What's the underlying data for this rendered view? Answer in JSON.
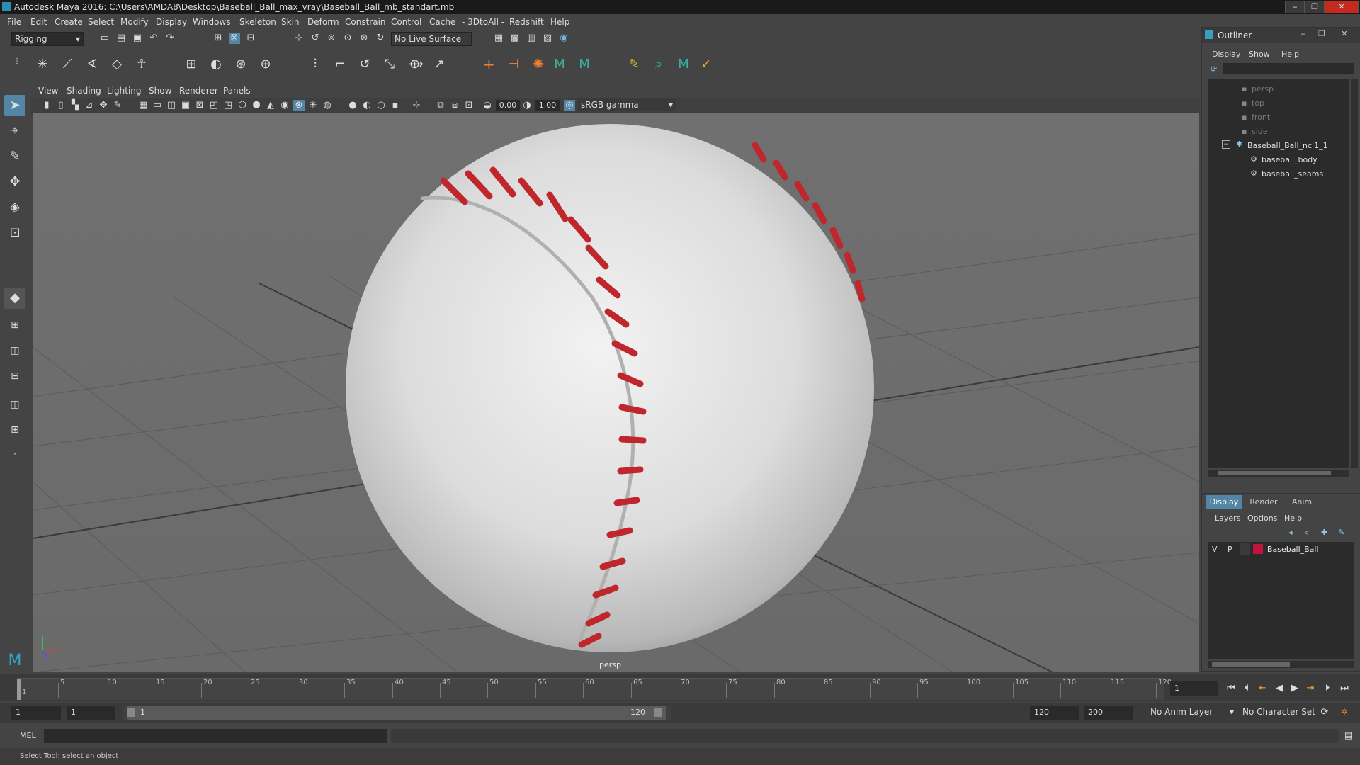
{
  "window": {
    "title": "Autodesk Maya 2016: C:\\Users\\AMDA8\\Desktop\\Baseball_Ball_max_vray\\Baseball_Ball_mb_standart.mb",
    "minimize": "‒",
    "maximize": "❐",
    "close": "✕"
  },
  "menu": [
    "File",
    "Edit",
    "Create",
    "Select",
    "Modify",
    "Display",
    "Windows",
    "Skeleton",
    "Skin",
    "Deform",
    "Constrain",
    "Control",
    "Cache",
    "- 3DtoAll -",
    "Redshift",
    "Help"
  ],
  "toolbar": {
    "mode": "Rigging",
    "live_surface": "No Live Surface"
  },
  "viewport": {
    "menu": [
      "View",
      "Shading",
      "Lighting",
      "Show",
      "Renderer",
      "Panels"
    ],
    "exposure": "0.00",
    "gamma": "1.00",
    "color_space": "sRGB gamma",
    "camera_label": "persp"
  },
  "outliner": {
    "title": "Outliner",
    "menu": [
      "Display",
      "Show",
      "Help"
    ],
    "items": [
      {
        "label": "persp"
      },
      {
        "label": "top"
      },
      {
        "label": "front"
      },
      {
        "label": "side"
      },
      {
        "label": "Baseball_Ball_ncl1_1"
      },
      {
        "label": "baseball_body"
      },
      {
        "label": "baseball_seams"
      }
    ],
    "collapse_glyph": "−"
  },
  "layer_editor": {
    "tabs": [
      "Display",
      "Render",
      "Anim"
    ],
    "menu": [
      "Layers",
      "Options",
      "Help"
    ],
    "layer": {
      "v": "V",
      "p": "P",
      "name": "Baseball_Ball",
      "color": "#c0143c"
    }
  },
  "timeline": {
    "ticks": [
      "1",
      "5",
      "10",
      "15",
      "20",
      "25",
      "30",
      "35",
      "40",
      "45",
      "50",
      "55",
      "60",
      "65",
      "70",
      "75",
      "80",
      "85",
      "90",
      "95",
      "100",
      "105",
      "110",
      "115",
      "120"
    ],
    "current_frame": "1"
  },
  "range": {
    "start": "1",
    "playback_start": "1",
    "slider_start": "1",
    "slider_end": "120",
    "playback_end": "120",
    "end": "200",
    "anim_layer": "No Anim Layer",
    "character_set": "No Character Set"
  },
  "command": {
    "label": "MEL"
  },
  "status": {
    "text": "Select Tool: select an object"
  },
  "colors": {
    "accent": "#5285a6",
    "seam": "#c0272d",
    "ball": "#e4e4e4"
  }
}
